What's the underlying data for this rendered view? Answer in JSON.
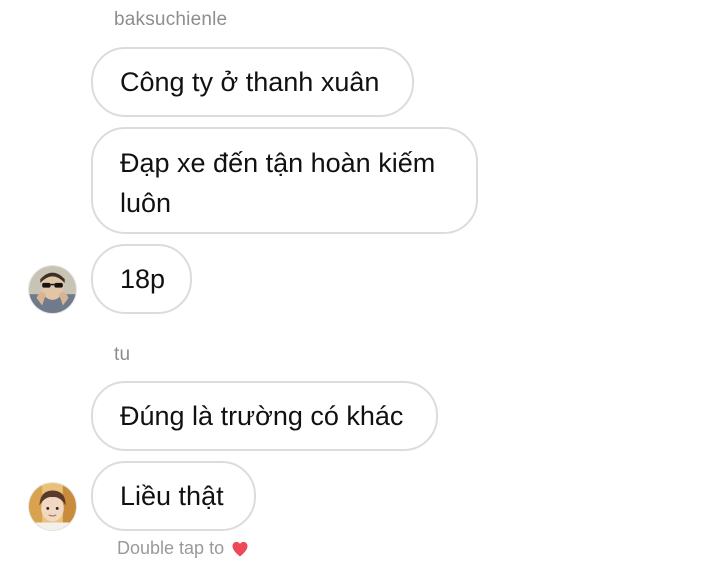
{
  "groups": [
    {
      "sender": "baksuchienle",
      "messages": [
        "Công ty ở thanh xuân",
        "Đạp xe đến tận hoàn kiếm luôn",
        "18p"
      ]
    },
    {
      "sender": "tu",
      "messages": [
        "Đúng là trường có khác",
        "Liều thật"
      ]
    }
  ],
  "footer": {
    "hint_text": "Double tap to",
    "icon": "heart-icon",
    "icon_color": "#ed4956"
  },
  "colors": {
    "bubble_border": "#dcdcdc",
    "sender_text": "#8e8e8e"
  }
}
